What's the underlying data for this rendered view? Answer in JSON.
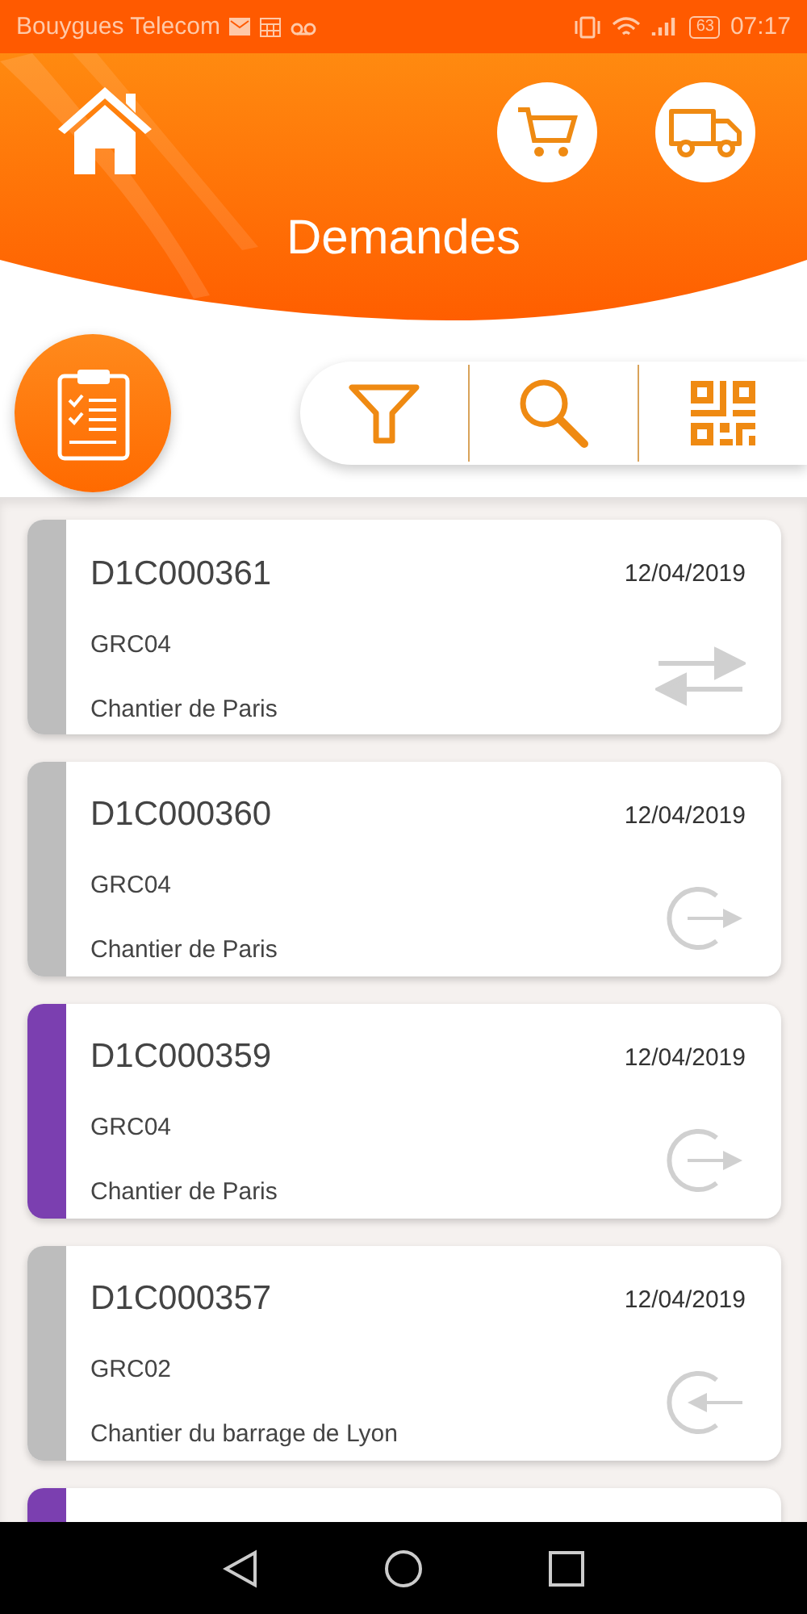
{
  "status_bar": {
    "carrier": "Bouygues Telecom",
    "battery": "63",
    "time": "07:17"
  },
  "header": {
    "title": "Demandes"
  },
  "cards": [
    {
      "code": "D1C000361",
      "date": "12/04/2019",
      "group": "GRC04",
      "site": "Chantier de Paris",
      "color": "#bdbdbd",
      "kind": "transfer"
    },
    {
      "code": "D1C000360",
      "date": "12/04/2019",
      "group": "GRC04",
      "site": "Chantier de Paris",
      "color": "#bdbdbd",
      "kind": "exit"
    },
    {
      "code": "D1C000359",
      "date": "12/04/2019",
      "group": "GRC04",
      "site": "Chantier de Paris",
      "color": "#7b3fb0",
      "kind": "exit"
    },
    {
      "code": "D1C000357",
      "date": "12/04/2019",
      "group": "GRC02",
      "site": "Chantier du barrage de Lyon",
      "color": "#bdbdbd",
      "kind": "enter"
    },
    {
      "color": "#7b3fb0",
      "kind": "peek"
    }
  ]
}
